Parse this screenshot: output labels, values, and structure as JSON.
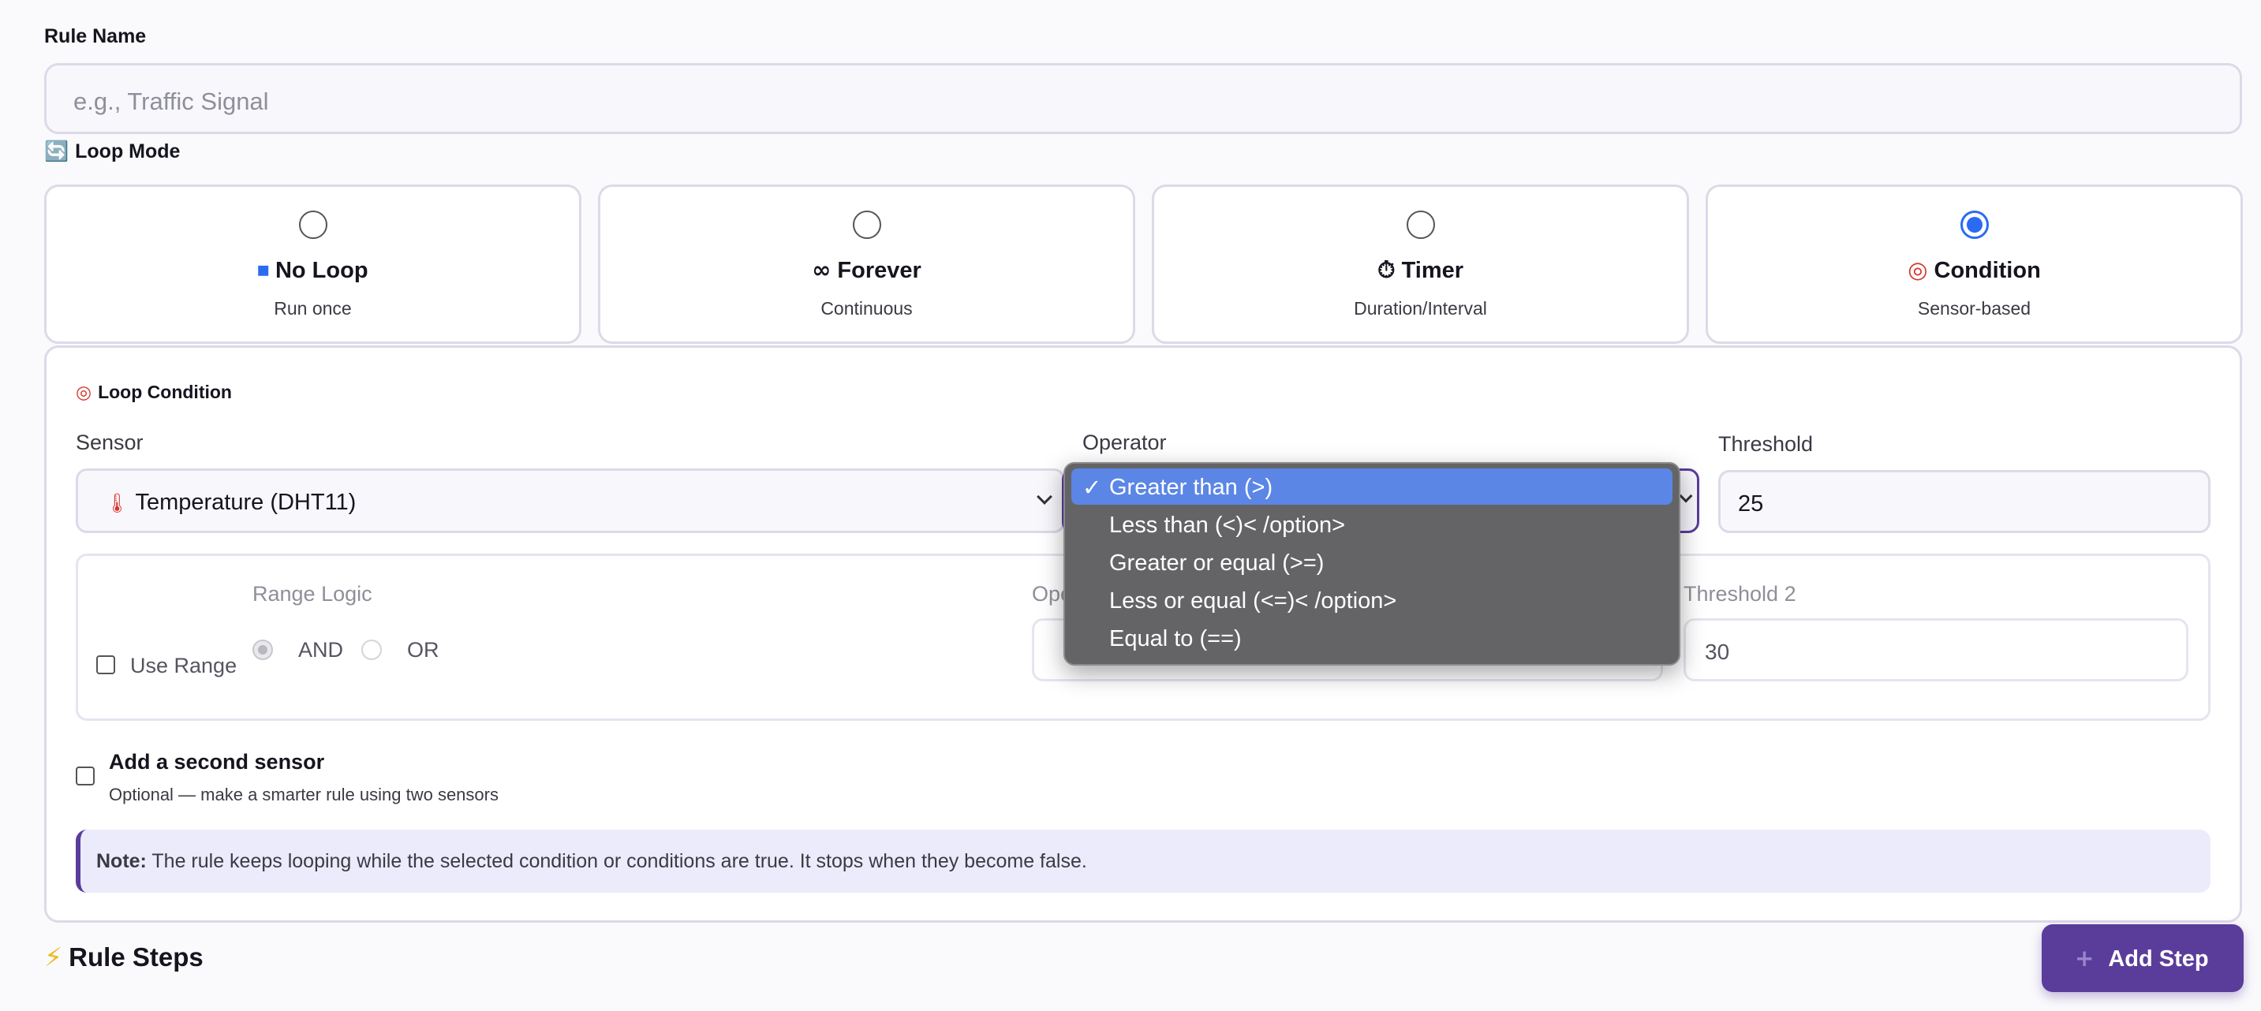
{
  "rule_name": {
    "label": "Rule Name",
    "placeholder": "e.g., Traffic Signal"
  },
  "loop_mode": {
    "icon": "refresh-icon",
    "label": "Loop Mode",
    "options": [
      {
        "icon": "stop-square-icon",
        "title": "No Loop",
        "subtitle": "Run once",
        "selected": false
      },
      {
        "icon": "infinity-icon",
        "title": "Forever",
        "subtitle": "Continuous",
        "selected": false
      },
      {
        "icon": "stopwatch-icon",
        "title": "Timer",
        "subtitle": "Duration/Interval",
        "selected": false
      },
      {
        "icon": "target-icon",
        "title": "Condition",
        "subtitle": "Sensor-based",
        "selected": true
      }
    ]
  },
  "loop_condition": {
    "icon": "target-icon",
    "title": "Loop Condition",
    "sensor_label": "Sensor",
    "sensor_value": "Temperature (DHT11)",
    "sensor_icon": "thermometer-icon",
    "operator_label": "Operator",
    "threshold_label": "Threshold",
    "threshold_value": "25",
    "range": {
      "use_range_label": "Use Range",
      "range_logic_label": "Range Logic",
      "and_label": "AND",
      "or_label": "OR",
      "operator2_label_partial": "Ope",
      "threshold2_label": "Threshold 2",
      "threshold2_value": "30"
    },
    "second_sensor": {
      "title": "Add a second sensor",
      "subtitle": "Optional — make a smarter rule using two sensors"
    },
    "note": {
      "strong": "Note:",
      "text": "The rule keeps looping while the selected condition or conditions are true. It stops when they become false."
    }
  },
  "operator_dropdown": {
    "options": [
      "Greater than (>)",
      "Less than (<)< /option>",
      "Greater or equal (>=)",
      "Less or equal (<=)< /option>",
      "Equal to (==)"
    ],
    "selected_index": 0
  },
  "rule_steps": {
    "icon": "lightning-icon",
    "title": "Rule Steps",
    "add_button": "Add Step"
  },
  "colors": {
    "accent": "#5a3d9b",
    "radio_selected": "#2a6bf2",
    "dropdown_highlight": "#5b86e5"
  }
}
